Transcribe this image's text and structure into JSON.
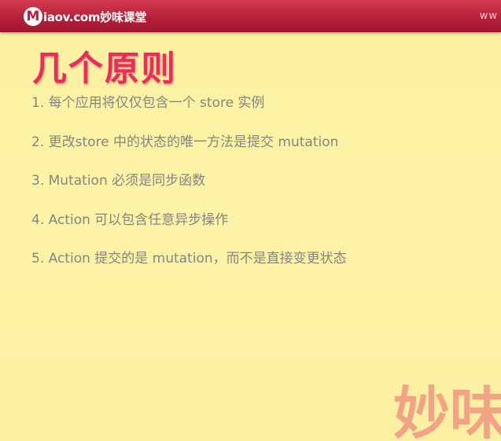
{
  "header": {
    "brand_mark": "M",
    "brand_text": "iaov.com妙味课堂",
    "url_fragment": "ww"
  },
  "slide": {
    "title": "几个原则",
    "rules": [
      "1. 每个应用将仅仅包含一个 store 实例",
      "2. 更改store 中的状态的唯一方法是提交 mutation",
      "3. Mutation 必须是同步函数",
      "4. Action 可以包含任意异步操作",
      "5. Action 提交的是 mutation，而不是直接变更状态"
    ]
  },
  "watermark": {
    "text": "妙味"
  },
  "colors": {
    "background": "#fdf3a6",
    "header": "#b6203a",
    "title": "#ee2b5c",
    "body_text": "#858585",
    "watermark": "#ec646e"
  }
}
